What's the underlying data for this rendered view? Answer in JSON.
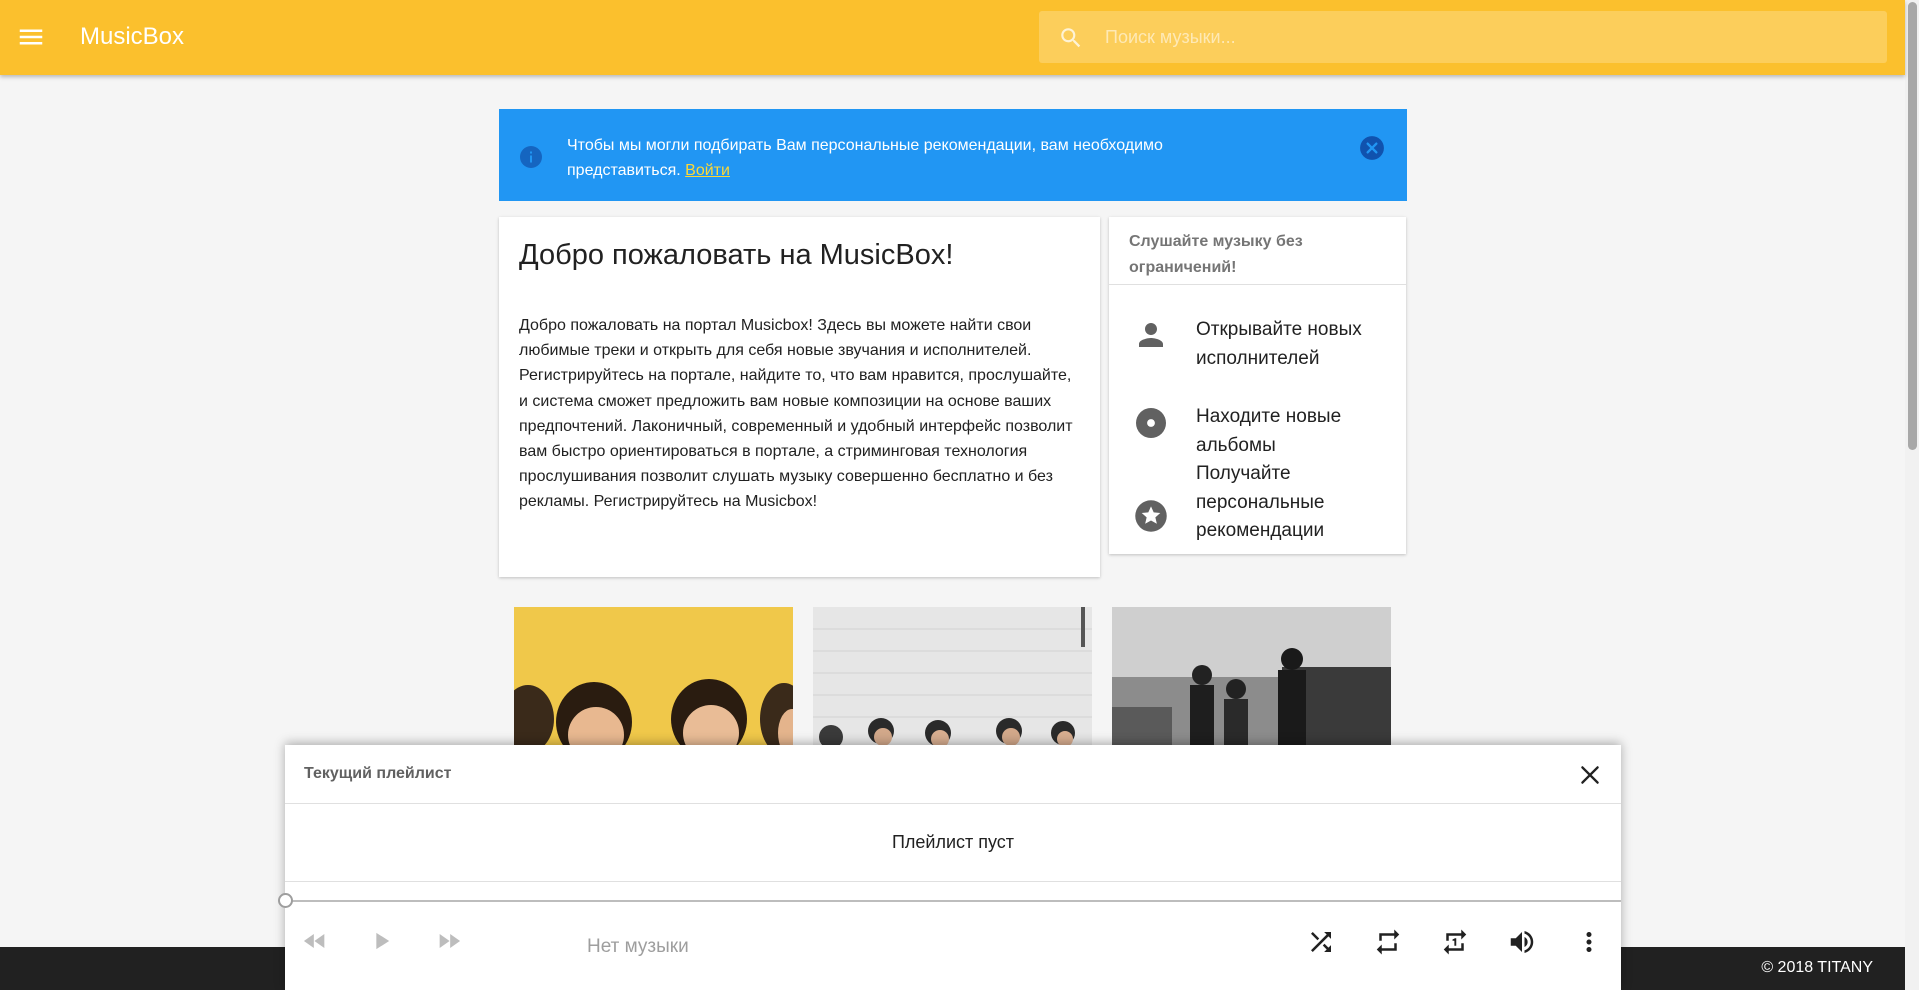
{
  "header": {
    "app_title": "MusicBox",
    "search_placeholder": "Поиск музыки...",
    "menu_icon": "menu-icon",
    "search_icon": "search-icon",
    "colors": {
      "toolbar": "#fbc02d"
    }
  },
  "banner": {
    "text": "Чтобы мы могли подбирать Вам персональные рекомендации, вам необходимо представиться.",
    "link_label": "Войти",
    "icon": "info-icon",
    "close_icon": "close-circle-icon",
    "colors": {
      "background": "#2196f3",
      "link": "#fdd835"
    }
  },
  "welcome": {
    "title": "Добро пожаловать на MusicBox!",
    "body": "Добро пожаловать на портал Musicbox! Здесь вы можете найти свои любимые треки и открыть для себя новые звучания и исполнителей. Регистрируйтесь на портале, найдите то, что вам нравится, прослушайте, и система сможет предложить вам новые композиции на основе ваших предпочтений. Лаконичный, современный и удобный интерфейс позволит вам быстро ориентироваться в портале, а стриминговая технология прослушивания позволит слушать музыку совершенно бесплатно и без рекламы. Регистрируйтесь на Musicbox!"
  },
  "features": {
    "header": "Слушайте музыку без ограничений!",
    "items": [
      {
        "icon": "person-icon",
        "label": "Открывайте новых исполнителей"
      },
      {
        "icon": "album-icon",
        "label": "Находите новые альбомы"
      },
      {
        "icon": "star-icon",
        "label": "Получайте персональные рекомендации"
      }
    ]
  },
  "albums": [
    {
      "image": "band-photo-yellow"
    },
    {
      "image": "band-photo-white-wall"
    },
    {
      "image": "band-photo-bw"
    }
  ],
  "player": {
    "title": "Текущий плейлист",
    "empty_text": "Плейлист пуст",
    "now_playing": "Нет музыки",
    "progress": 0,
    "controls": [
      "previous-icon",
      "play-icon",
      "next-icon",
      "shuffle-icon",
      "repeat-icon",
      "repeat-one-icon",
      "volume-icon",
      "more-vert-icon"
    ]
  },
  "footer": {
    "copyright": "© 2018 TITANY"
  }
}
